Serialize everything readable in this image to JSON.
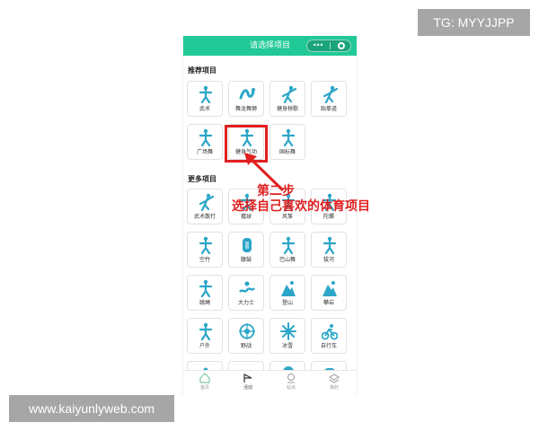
{
  "overlay": {
    "tg": "TG: MYYJJPP",
    "website": "www.kaiyunlyweb.com"
  },
  "header": {
    "title": "请选择项目",
    "capsule_dots": "•••"
  },
  "sections": [
    {
      "title": "推荐项目",
      "items": [
        {
          "label": "武术",
          "icon": "martial-arts"
        },
        {
          "label": "舞龙舞狮",
          "icon": "dragon-dance"
        },
        {
          "label": "健身秧歌",
          "icon": "yangge"
        },
        {
          "label": "跆拳道",
          "icon": "taekwondo"
        },
        {
          "label": "广场舞",
          "icon": "square-dance"
        },
        {
          "label": "健身气功",
          "icon": "qigong"
        },
        {
          "label": "国标舞",
          "icon": "ballroom"
        }
      ]
    },
    {
      "title": "更多项目",
      "items": [
        {
          "label": "武术散打",
          "icon": "sanda"
        },
        {
          "label": "毽球",
          "icon": "shuttlecock"
        },
        {
          "label": "风筝",
          "icon": "kite"
        },
        {
          "label": "陀螺",
          "icon": "top"
        },
        {
          "label": "空竹",
          "icon": "diabolo"
        },
        {
          "label": "腰鼓",
          "icon": "waist-drum"
        },
        {
          "label": "巴山舞",
          "icon": "bashan-dance"
        },
        {
          "label": "拔河",
          "icon": "tug-of-war"
        },
        {
          "label": "跳绳",
          "icon": "rope-skipping"
        },
        {
          "label": "大力士",
          "icon": "strongman"
        },
        {
          "label": "登山",
          "icon": "mountaineering"
        },
        {
          "label": "攀岩",
          "icon": "rock-climbing"
        },
        {
          "label": "户外",
          "icon": "outdoor"
        },
        {
          "label": "野战",
          "icon": "field-combat"
        },
        {
          "label": "冰雪",
          "icon": "snowflake"
        },
        {
          "label": "自行车",
          "icon": "cycling"
        },
        {
          "label": "",
          "icon": "rowing"
        },
        {
          "label": "",
          "icon": "skateboard"
        },
        {
          "label": "",
          "icon": "map-pin"
        },
        {
          "label": "",
          "icon": "gloves"
        }
      ]
    }
  ],
  "bottom_nav": [
    {
      "label": "首页",
      "icon": "home"
    },
    {
      "label": "活动",
      "icon": "activity",
      "active": true
    },
    {
      "label": "站点",
      "icon": "location"
    },
    {
      "label": "我的",
      "icon": "layers"
    }
  ],
  "annotation": {
    "line1": "第二步",
    "line2": "选择自己喜欢的体育项目"
  },
  "colors": {
    "accent": "#21c997",
    "icon": "#2ba6c8",
    "annotation": "#e02020"
  }
}
